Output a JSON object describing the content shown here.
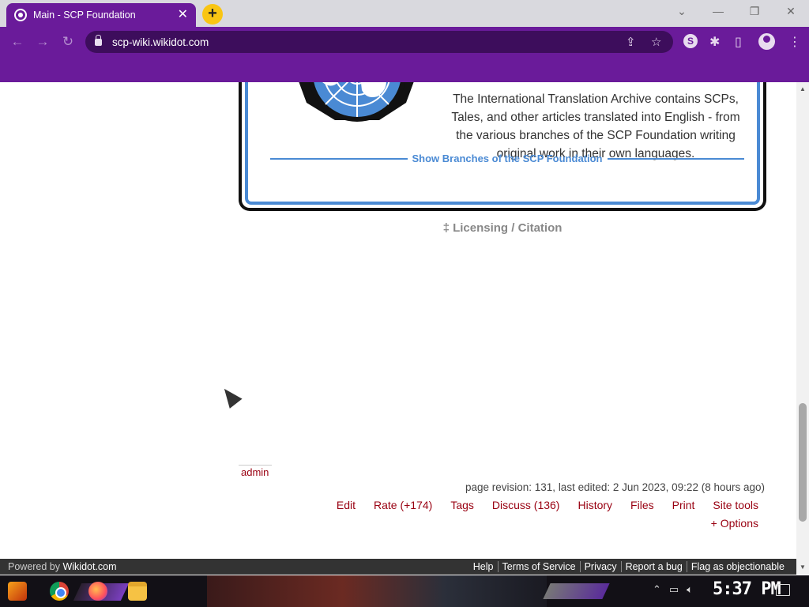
{
  "browser": {
    "tab_title": "Main - SCP Foundation",
    "tab_close": "✕",
    "new_tab": "+",
    "url": "scp-wiki.wikidot.com",
    "window_controls": [
      "⌄",
      "—",
      "❐",
      "✕"
    ],
    "extension_badge": "S",
    "accent_color": "#6a1b9a"
  },
  "page": {
    "archive_text": "The International Translation Archive contains SCPs, Tales, and other articles translated into English - from the various branches of the SCP Foundation writing original work in their own languages.",
    "branches_link": "Show Branches of the SCP Foundation",
    "licensing": "‡ Licensing / Citation",
    "author": "admin",
    "revision_info": "page revision: 131, last edited: 2 Jun 2023, 09:22 (8 hours ago)",
    "actions": [
      "Edit",
      "Rate (+174)",
      "Tags",
      "Discuss (136)",
      "History",
      "Files",
      "Print",
      "Site tools"
    ],
    "options": "+ Options"
  },
  "footer": {
    "powered_prefix": "Powered by ",
    "powered_brand": "Wikidot.com",
    "links": [
      "Help",
      "Terms of Service",
      "Privacy",
      "Report a bug",
      "Flag as objectionable"
    ]
  },
  "taskbar": {
    "clock": "5:37 PM"
  }
}
